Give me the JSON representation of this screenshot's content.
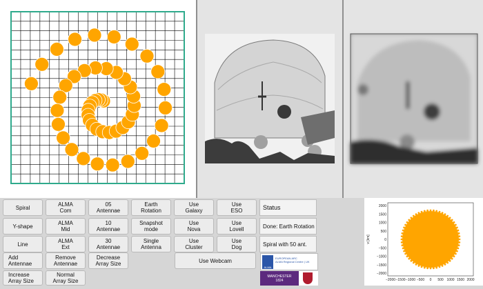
{
  "array_plot": {
    "dish_color": "#ffa500",
    "grid_color": "#000000",
    "border_color": "#2eaa8c"
  },
  "buttons": {
    "col1": [
      "Spiral",
      "Y-shape",
      "Line",
      "Add\nAntennae",
      "Increase\nArray Size"
    ],
    "col2": [
      "ALMA\nCom",
      "ALMA\nMid",
      "ALMA\nExt",
      "Remove\nAntennae",
      "Normal\nArray Size"
    ],
    "col3": [
      "05\nAntennae",
      "10\nAntennae",
      "30\nAntennae",
      "Decrease\nArray Size"
    ],
    "col4": [
      "Earth\nRotation",
      "Snapshot\nmode",
      "Single\nAntenna"
    ],
    "col5": [
      "Use\nGalaxy",
      "Use\nNova",
      "Use\nCluster"
    ],
    "col6": [
      "Use\nESO",
      "Use\nLovell",
      "Use\nDog"
    ],
    "webcam": "Use Webcam"
  },
  "status": {
    "title": "Status",
    "line1": "Done: Earth Rotation",
    "line2": "Spiral with 50 ant."
  },
  "logos": {
    "alma_text": "EUROPEAN ARC\nALMA Regional Centre | UK",
    "alma_word": "ALMA",
    "manchester": "MANCHESTER\n1824"
  },
  "uv_plot": {
    "ylabel": "v [km]",
    "fill_color": "#ffa500",
    "xticks": [
      "−2000",
      "−1500",
      "−1000",
      "−500",
      "0",
      "500",
      "1000",
      "1500",
      "2000"
    ],
    "yticks": [
      "2000",
      "1500",
      "1000",
      "500",
      "0",
      "−500",
      "−1000",
      "−1500",
      "−2000"
    ]
  }
}
